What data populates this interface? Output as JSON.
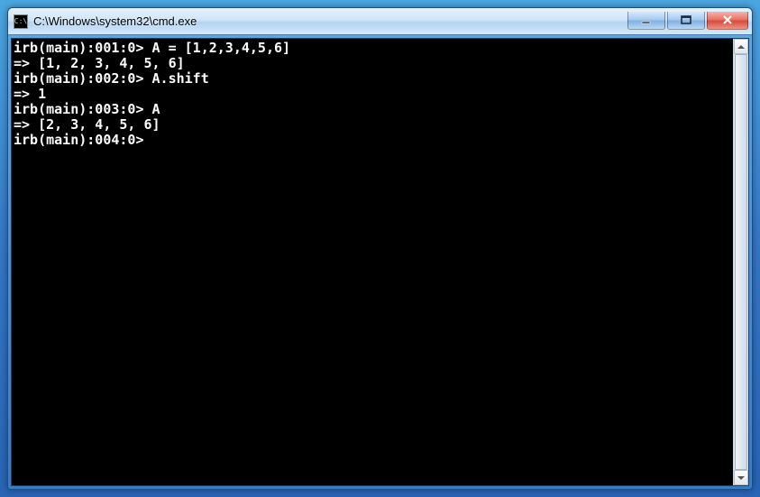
{
  "window": {
    "title": "C:\\Windows\\system32\\cmd.exe",
    "icon_label": "C:\\"
  },
  "terminal": {
    "lines": [
      {
        "prompt": "irb(main):001:0>",
        "input": "A = [1,2,3,4,5,6]"
      },
      {
        "output": "=> [1, 2, 3, 4, 5, 6]"
      },
      {
        "prompt": "irb(main):002:0>",
        "input": "A.shift"
      },
      {
        "output": "=> 1"
      },
      {
        "prompt": "irb(main):003:0>",
        "input": "A"
      },
      {
        "output": "=> [2, 3, 4, 5, 6]"
      },
      {
        "prompt": "irb(main):004:0>",
        "input": ""
      }
    ]
  }
}
